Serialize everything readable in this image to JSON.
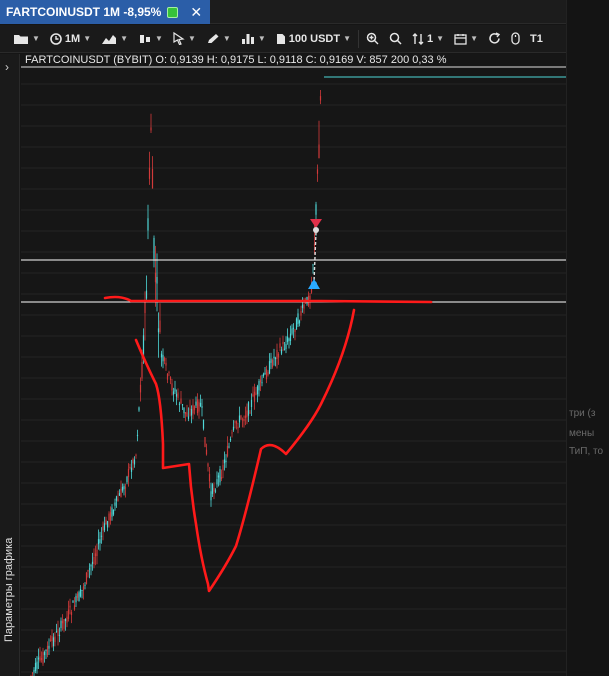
{
  "tab": {
    "title": "FARTCOINUSDT 1M -8,95%",
    "close": "✕"
  },
  "toolbar": {
    "timeframe": "1M",
    "quantity": "100 USDT",
    "sort": "1",
    "last": "T1"
  },
  "ohlc": {
    "symbol": "FARTCOINUSDT (BYBIT)",
    "text": "O: 0,9139  H: 0,9175  L: 0,9118  C: 0,9169  V: 857 200  0,33 %"
  },
  "sidebar": {
    "label": "Параметры графика",
    "toggle": "›"
  },
  "right_panel": {
    "fragments": [
      "три (з",
      "мены",
      "ТиП, то"
    ]
  },
  "colors": {
    "bull": "#4fd8d8",
    "bear": "#d23a3a",
    "drawing": "#ff1a1a",
    "line": "#ffffff",
    "buy_marker": "#2aa8ff",
    "sell_marker": "#e0304a"
  }
}
